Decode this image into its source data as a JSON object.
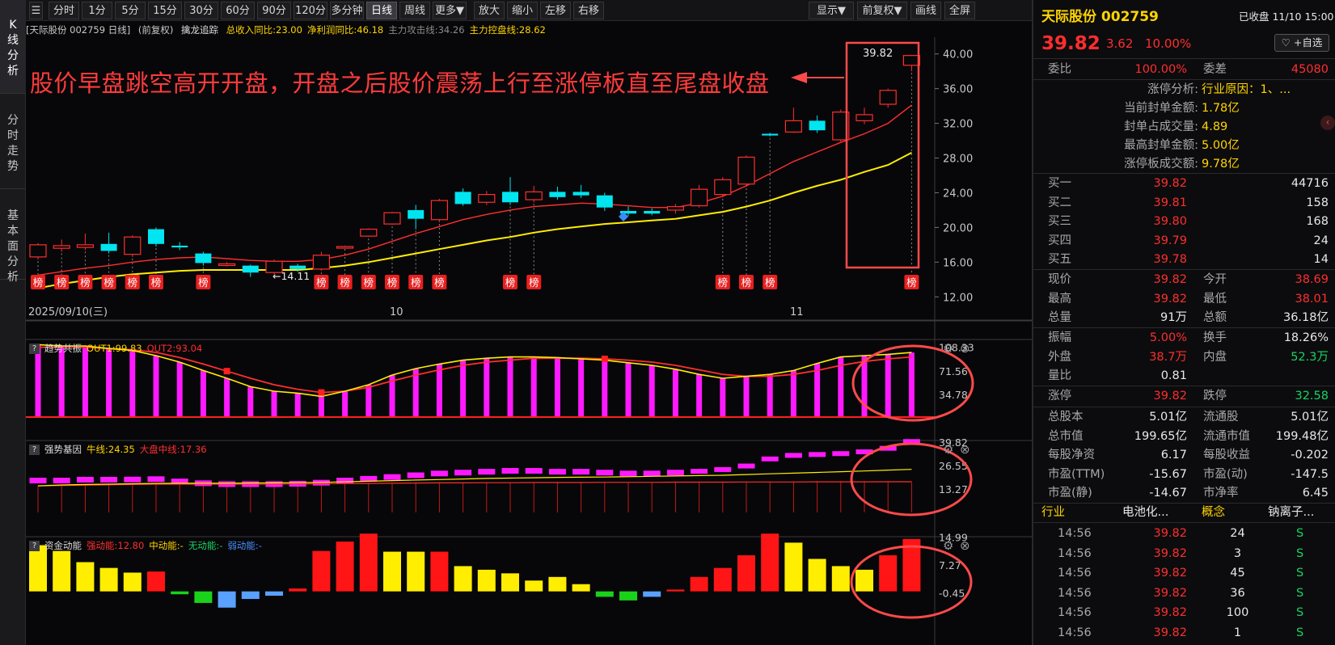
{
  "left_tabs": [
    "K线分析",
    "分时走势",
    "基本面分析"
  ],
  "toolbar": {
    "periods": [
      "分时",
      "1分",
      "5分",
      "15分",
      "30分",
      "60分",
      "90分",
      "120分",
      "多分钟",
      "日线",
      "周线",
      "更多▼"
    ],
    "active_period": "日线",
    "actions": [
      "放大",
      "缩小",
      "左移",
      "右移"
    ],
    "right": [
      "显示▼",
      "前复权▼",
      "画线",
      "全屏"
    ]
  },
  "main_chart": {
    "header": {
      "stock": "[天际股份 002759 日线]",
      "adjust": "(前复权)",
      "indicator": "擒龙追踪",
      "items": [
        {
          "label": "总收入同比:23.00",
          "color": "#ffd400"
        },
        {
          "label": "净利润同比:46.18",
          "color": "#ffd400"
        },
        {
          "label": "主力攻击线:34.26",
          "color": "#8a8a8a"
        },
        {
          "label": "主力控盘线:28.62",
          "color": "#ffd400"
        }
      ]
    },
    "annotation": "股价早盘跳空高开开盘，开盘之后股价震荡上行至涨停板直至尾盘收盘",
    "highlight_price": "39.82",
    "low_label": "←14.11",
    "bang_label": "榜",
    "y_ticks": [
      "40.00",
      "36.00",
      "32.00",
      "28.00",
      "24.00",
      "20.00",
      "16.00",
      "12.00"
    ],
    "date_labels": [
      "2025/09/10(三)",
      "10",
      "11"
    ],
    "colors": {
      "up": "#ff2e2e",
      "down": "#00e5f0",
      "ma_fast": "#ff2e2e",
      "ma_slow": "#ffee00"
    }
  },
  "chart_data": [
    {
      "type": "candlestick",
      "title": "天际股份 002759 日线",
      "y_ticks": [
        40,
        36,
        32,
        28,
        24,
        20,
        16,
        12
      ],
      "ylim": [
        11,
        41
      ],
      "candles": [
        {
          "o": 16.6,
          "c": 18.0,
          "h": 18.2,
          "l": 16.3
        },
        {
          "o": 17.6,
          "c": 17.9,
          "h": 18.6,
          "l": 17.2
        },
        {
          "o": 17.7,
          "c": 18.0,
          "h": 19.3,
          "l": 17.4
        },
        {
          "o": 18.1,
          "c": 17.3,
          "h": 19.4,
          "l": 17.0
        },
        {
          "o": 16.9,
          "c": 18.9,
          "h": 19.1,
          "l": 16.6
        },
        {
          "o": 19.8,
          "c": 18.1,
          "h": 20.0,
          "l": 17.8
        },
        {
          "o": 17.9,
          "c": 17.7,
          "h": 18.3,
          "l": 17.4
        },
        {
          "o": 17.0,
          "c": 15.9,
          "h": 17.2,
          "l": 15.6
        },
        {
          "o": 15.8,
          "c": 15.8,
          "h": 16.0,
          "l": 15.5
        },
        {
          "o": 15.6,
          "c": 14.8,
          "h": 15.7,
          "l": 14.3
        },
        {
          "o": 14.8,
          "c": 16.1,
          "h": 16.3,
          "l": 14.6
        },
        {
          "o": 15.6,
          "c": 15.2,
          "h": 15.8,
          "l": 14.9
        },
        {
          "o": 15.2,
          "c": 16.8,
          "h": 17.2,
          "l": 15.0
        },
        {
          "o": 17.8,
          "c": 17.8,
          "h": 17.9,
          "l": 17.7
        },
        {
          "o": 19.0,
          "c": 19.8,
          "h": 19.9,
          "l": 18.9
        },
        {
          "o": 20.4,
          "c": 21.7,
          "h": 21.8,
          "l": 20.3
        },
        {
          "o": 22.0,
          "c": 21.0,
          "h": 22.6,
          "l": 19.8
        },
        {
          "o": 20.9,
          "c": 23.1,
          "h": 23.3,
          "l": 20.6
        },
        {
          "o": 24.1,
          "c": 22.7,
          "h": 24.5,
          "l": 22.5
        },
        {
          "o": 22.9,
          "c": 23.8,
          "h": 24.2,
          "l": 22.6
        },
        {
          "o": 24.1,
          "c": 22.9,
          "h": 25.8,
          "l": 22.6
        },
        {
          "o": 23.2,
          "c": 24.1,
          "h": 24.8,
          "l": 22.9
        },
        {
          "o": 24.1,
          "c": 23.5,
          "h": 24.7,
          "l": 23.2
        },
        {
          "o": 24.1,
          "c": 23.7,
          "h": 24.9,
          "l": 23.4
        },
        {
          "o": 23.7,
          "c": 22.3,
          "h": 24.0,
          "l": 21.9
        },
        {
          "o": 21.9,
          "c": 21.6,
          "h": 22.4,
          "l": 21.3
        },
        {
          "o": 21.9,
          "c": 21.6,
          "h": 22.2,
          "l": 21.4
        },
        {
          "o": 22.0,
          "c": 22.4,
          "h": 22.7,
          "l": 21.6
        },
        {
          "o": 22.5,
          "c": 24.4,
          "h": 24.9,
          "l": 22.3
        },
        {
          "o": 23.8,
          "c": 25.5,
          "h": 25.8,
          "l": 23.5
        },
        {
          "o": 25.0,
          "c": 28.1,
          "h": 28.3,
          "l": 24.7
        },
        {
          "o": 30.8,
          "c": 30.6,
          "h": 30.9,
          "l": 30.5
        },
        {
          "o": 31.0,
          "c": 32.3,
          "h": 33.8,
          "l": 30.9
        },
        {
          "o": 32.3,
          "c": 31.2,
          "h": 32.9,
          "l": 30.9
        },
        {
          "o": 30.1,
          "c": 33.3,
          "h": 33.6,
          "l": 29.9
        },
        {
          "o": 32.3,
          "c": 33.0,
          "h": 33.8,
          "l": 31.9
        },
        {
          "o": 34.2,
          "c": 35.8,
          "h": 36.0,
          "l": 33.8
        },
        {
          "o": 38.69,
          "c": 39.82,
          "h": 39.82,
          "l": 38.01
        }
      ],
      "ma_fast": [
        14.5,
        14.9,
        15.3,
        15.6,
        16.0,
        16.3,
        16.5,
        16.6,
        16.4,
        16.2,
        16.1,
        16.1,
        16.3,
        16.8,
        17.5,
        18.4,
        19.3,
        20.1,
        20.9,
        21.5,
        22.0,
        22.4,
        22.6,
        22.8,
        22.7,
        22.5,
        22.3,
        22.3,
        22.8,
        23.6,
        24.8,
        26.2,
        27.6,
        28.7,
        29.8,
        30.8,
        32.0,
        34.1
      ],
      "ma_slow": [
        13.0,
        13.5,
        13.9,
        14.3,
        14.6,
        14.8,
        15.0,
        15.1,
        15.1,
        15.1,
        15.1,
        15.1,
        15.3,
        15.6,
        16.0,
        16.5,
        17.0,
        17.5,
        18.0,
        18.5,
        18.9,
        19.4,
        19.8,
        20.1,
        20.4,
        20.6,
        20.8,
        21.0,
        21.4,
        21.8,
        22.4,
        23.1,
        24.0,
        24.8,
        25.5,
        26.4,
        27.2,
        28.62
      ],
      "bang_days": [
        0,
        1,
        2,
        3,
        4,
        5,
        7,
        12,
        13,
        14,
        15,
        16,
        17,
        20,
        21,
        29,
        30,
        31,
        37
      ]
    },
    {
      "type": "bar",
      "title": "趋势共振",
      "series_labels": [
        {
          "name": "OUT1:99.83",
          "color": "#ffd400"
        },
        {
          "name": "OUT2:93.04",
          "color": "#ff2e2e"
        }
      ],
      "y_ticks": [
        108.33,
        71.56,
        34.78
      ],
      "ylim": [
        0,
        115
      ],
      "values": [
        112,
        110,
        110,
        106,
        103,
        95,
        85,
        72,
        60,
        47,
        40,
        37,
        32,
        40,
        50,
        65,
        75,
        82,
        88,
        91,
        93,
        93,
        92,
        90,
        88,
        84,
        80,
        74,
        66,
        60,
        63,
        66,
        72,
        83,
        93,
        95,
        97,
        99.83
      ],
      "line2": [
        108,
        108,
        108,
        106,
        104,
        100,
        92,
        82,
        71,
        60,
        50,
        43,
        38,
        40,
        46,
        56,
        65,
        73,
        80,
        85,
        88,
        91,
        91,
        91,
        90,
        88,
        85,
        80,
        73,
        66,
        63,
        63,
        66,
        72,
        80,
        86,
        90,
        93.04
      ]
    },
    {
      "type": "bar",
      "title": "强势基因",
      "series_labels": [
        {
          "name": "牛线:24.35",
          "color": "#ffd400"
        },
        {
          "name": "大盘中线:17.36",
          "color": "#ff2e2e"
        }
      ],
      "y_ticks": [
        39.82,
        26.55,
        13.27
      ],
      "ylim": [
        0,
        42
      ],
      "values": [
        18,
        18,
        18.5,
        18.5,
        18.6,
        18.8,
        17.5,
        16.5,
        16,
        16,
        16,
        16.2,
        16.8,
        18,
        19,
        20,
        21,
        22,
        22.5,
        23,
        23.5,
        23.5,
        23,
        23,
        22.5,
        22,
        22,
        22.5,
        23,
        24,
        26,
        30,
        32,
        32.5,
        33,
        34,
        36,
        39.82
      ],
      "bull": [
        15,
        15.5,
        15.8,
        16,
        16.2,
        16.4,
        16.5,
        16.5,
        16.5,
        16.6,
        16.7,
        16.8,
        17,
        17.3,
        17.6,
        18,
        18.3,
        18.6,
        18.9,
        19.2,
        19.4,
        19.6,
        19.8,
        19.9,
        20,
        20.2,
        20.4,
        20.6,
        20.8,
        21,
        21.4,
        21.8,
        22.2,
        22.6,
        23,
        23.4,
        23.9,
        24.35
      ],
      "market": [
        15,
        15.2,
        15.4,
        15.6,
        15.8,
        16,
        16,
        16,
        16,
        16,
        16,
        16.1,
        16.2,
        16.3,
        16.4,
        16.5,
        16.6,
        16.7,
        16.7,
        16.8,
        16.8,
        16.9,
        16.9,
        16.9,
        17,
        17,
        17,
        17.1,
        17.1,
        17.1,
        17.2,
        17.2,
        17.2,
        17.3,
        17.3,
        17.3,
        17.35,
        17.36
      ]
    },
    {
      "type": "bar",
      "title": "资金动能",
      "series_labels": [
        {
          "name": "强动能:12.80",
          "color": "#ff2e2e"
        },
        {
          "name": "中动能:-",
          "color": "#ffd400"
        },
        {
          "name": "无动能:-",
          "color": "#19d263"
        },
        {
          "name": "弱动能:-",
          "color": "#4a90ff"
        }
      ],
      "y_ticks": [
        14.99,
        7.27,
        -0.45
      ],
      "ylim": [
        -5,
        16.5
      ],
      "values": [
        12.8,
        11.2,
        8.1,
        6.5,
        5.2,
        5.5,
        -0.8,
        -3.2,
        -4.5,
        -2.1,
        -1.2,
        0.8,
        11.2,
        13.8,
        16.0,
        11.0,
        11.0,
        11.0,
        7.0,
        6.0,
        5.0,
        3.0,
        4.0,
        2.0,
        -1.5,
        -2.5,
        -1.5,
        0.5,
        4.0,
        6.5,
        10.0,
        16.0,
        13.5,
        9.0,
        7.0,
        6.0,
        10.0,
        14.5
      ],
      "kinds": [
        "y",
        "y",
        "y",
        "y",
        "y",
        "r",
        "g",
        "g",
        "b",
        "b",
        "b",
        "r",
        "r",
        "r",
        "r",
        "y",
        "y",
        "r",
        "y",
        "y",
        "y",
        "y",
        "y",
        "y",
        "g",
        "g",
        "b",
        "r",
        "r",
        "r",
        "r",
        "r",
        "y",
        "y",
        "y",
        "y",
        "r",
        "r"
      ]
    }
  ],
  "panel_headers": [
    {
      "title": "趋势共振",
      "items": [
        {
          "t": "OUT1:99.83",
          "c": "#ffd400"
        },
        {
          "t": "OUT2:93.04",
          "c": "#ff2e2e"
        }
      ]
    },
    {
      "title": "强势基因",
      "items": [
        {
          "t": "牛线:24.35",
          "c": "#ffd400"
        },
        {
          "t": "大盘中线:17.36",
          "c": "#ff2e2e"
        }
      ]
    },
    {
      "title": "资金动能",
      "items": [
        {
          "t": "强动能:12.80",
          "c": "#ff2e2e"
        },
        {
          "t": "中动能:-",
          "c": "#ffd400"
        },
        {
          "t": "无动能:-",
          "c": "#19d263"
        },
        {
          "t": "弱动能:-",
          "c": "#4a90ff"
        }
      ]
    }
  ],
  "right_panel": {
    "name": "天际股份 002759",
    "status": "已收盘 11/10 15:00",
    "price": "39.82",
    "change": "3.62",
    "change_pct": "10.00%",
    "watch_button": "♡ +自选",
    "weibi_label": "委比",
    "weibi": "100.00%",
    "weicha_label": "委差",
    "weicha": "45080",
    "limit_analysis": [
      {
        "k": "涨停分析:",
        "v": "行业原因：1、..."
      },
      {
        "k": "当前封单金额:",
        "v": "1.78亿"
      },
      {
        "k": "封单占成交量:",
        "v": "4.89"
      },
      {
        "k": "最高封单金额:",
        "v": "5.00亿"
      },
      {
        "k": "涨停板成交额:",
        "v": "9.78亿"
      }
    ],
    "bids": [
      {
        "label": "买一",
        "price": "39.82",
        "vol": "44716"
      },
      {
        "label": "买二",
        "price": "39.81",
        "vol": "158"
      },
      {
        "label": "买三",
        "price": "39.80",
        "vol": "168"
      },
      {
        "label": "买四",
        "price": "39.79",
        "vol": "24"
      },
      {
        "label": "买五",
        "price": "39.78",
        "vol": "14"
      }
    ],
    "quote_rows": [
      [
        {
          "k": "现价",
          "v": "39.82",
          "c": "red"
        },
        {
          "k": "今开",
          "v": "38.69",
          "c": "red"
        }
      ],
      [
        {
          "k": "最高",
          "v": "39.82",
          "c": "red"
        },
        {
          "k": "最低",
          "v": "38.01",
          "c": "red"
        }
      ],
      [
        {
          "k": "总量",
          "v": "91万",
          "c": "white"
        },
        {
          "k": "总额",
          "v": "36.18亿",
          "c": "white"
        }
      ]
    ],
    "quote_rows2": [
      [
        {
          "k": "振幅",
          "v": "5.00%",
          "c": "red"
        },
        {
          "k": "换手",
          "v": "18.26%",
          "c": "white"
        }
      ],
      [
        {
          "k": "外盘",
          "v": "38.7万",
          "c": "red"
        },
        {
          "k": "内盘",
          "v": "52.3万",
          "c": "green"
        }
      ],
      [
        {
          "k": "量比",
          "v": "0.81",
          "c": "white"
        }
      ]
    ],
    "limit_row": [
      {
        "k": "涨停",
        "v": "39.82",
        "c": "red"
      },
      {
        "k": "跌停",
        "v": "32.58",
        "c": "green"
      }
    ],
    "fundamentals": [
      [
        {
          "k": "总股本",
          "v": "5.01亿"
        },
        {
          "k": "流通股",
          "v": "5.01亿"
        }
      ],
      [
        {
          "k": "总市值",
          "v": "199.65亿"
        },
        {
          "k": "流通市值",
          "v": "199.48亿"
        }
      ],
      [
        {
          "k": "每股净资",
          "v": "6.17"
        },
        {
          "k": "每股收益",
          "v": "-0.202"
        }
      ],
      [
        {
          "k": "市盈(TTM)",
          "v": "-15.67"
        },
        {
          "k": "市盈(动)",
          "v": "-147.5"
        }
      ],
      [
        {
          "k": "市盈(静)",
          "v": "-14.67"
        },
        {
          "k": "市净率",
          "v": "6.45"
        }
      ]
    ],
    "industry_label": "行业",
    "industry_value": "电池化...",
    "concept_label": "概念",
    "concept_value": "钠离子...",
    "ticks": [
      {
        "time": "14:56",
        "price": "39.82",
        "vol": "24",
        "side": "S"
      },
      {
        "time": "14:56",
        "price": "39.82",
        "vol": "3",
        "side": "S"
      },
      {
        "time": "14:56",
        "price": "39.82",
        "vol": "45",
        "side": "S"
      },
      {
        "time": "14:56",
        "price": "39.82",
        "vol": "36",
        "side": "S"
      },
      {
        "time": "14:56",
        "price": "39.82",
        "vol": "100",
        "side": "S"
      },
      {
        "time": "14:56",
        "price": "39.82",
        "vol": "1",
        "side": "S"
      }
    ]
  }
}
